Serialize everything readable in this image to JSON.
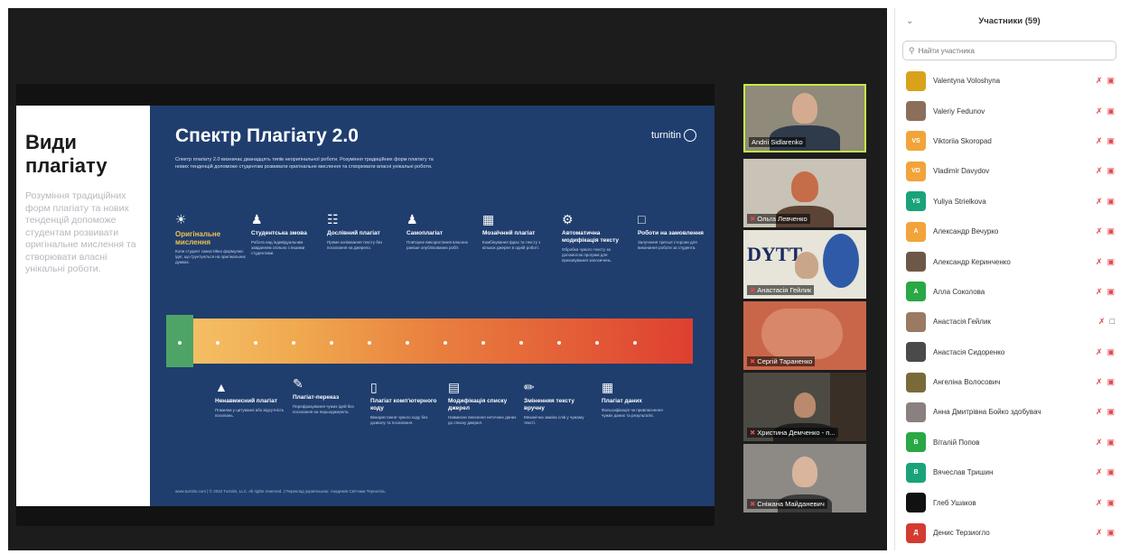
{
  "slide": {
    "left_heading": "Види плагіату",
    "left_text": "Розуміння традиційних форм плагіату та нових тенденцій допоможе студентам розвивати оригінальне мислення та створювати власні унікальні роботи.",
    "title": "Спектр Плагіату 2.0",
    "brand": "turnitin",
    "intro": "Спектр плагіату 2.0 визначає дванадцять типів неоригінальної роботи. Розуміння традиційних форм плагіату та нових тенденцій допоможе студентам розвивати оригінальне мислення та створювати власні унікальні роботи.",
    "top_items": [
      {
        "label": "Оригінальне мислення",
        "desc": "Коли студент самостійно формулює ідеї, що ґрунтуються на оригінальних думках."
      },
      {
        "label": "Студентська змова",
        "desc": "Робота над індивідуальним завданням спільно з іншими студентами."
      },
      {
        "label": "Дослівний плагіат",
        "desc": "Пряме копіювання тексту без посилання на джерело."
      },
      {
        "label": "Самоплагіат",
        "desc": "Повторне використання власних раніше опублікованих робіт."
      },
      {
        "label": "Мозаїчний плагіат",
        "desc": "Комбінування фраз та тексту з кількох джерел в одній роботі."
      },
      {
        "label": "Автоматична модифікація тексту",
        "desc": "Обробка чужого тексту за допомогою програм для приховування запозичень."
      },
      {
        "label": "Роботи на замовлення",
        "desc": "Залучення третьої сторони для виконання роботи за студента."
      }
    ],
    "bottom_items": [
      {
        "label": "Ненавмисний плагіат",
        "desc": "Помилки у цитуванні або відсутність посилань."
      },
      {
        "label": "Плагіат-переказ",
        "desc": "Перефразування чужих ідей без посилання на першоджерело."
      },
      {
        "label": "Плагіат комп'ютерного коду",
        "desc": "Використання чужого коду без дозволу та посилання."
      },
      {
        "label": "Модифікація списку джерел",
        "desc": "Навмисне внесення неточних даних до списку джерел."
      },
      {
        "label": "Зміненняя тексту вручну",
        "desc": "Механічна заміна слів у чужому тексті."
      },
      {
        "label": "Плагіат даних",
        "desc": "Фальсифікація чи привласнення чужих даних та результатів."
      }
    ],
    "footer": "www.turnitin.com | © 2022 Turnitin, LLC. All rights reserved. | Переклад українською: Академія Світчаки Тернопіль"
  },
  "tiles": [
    {
      "name": "Andrii Sidlarenko",
      "muted": false,
      "active": true
    },
    {
      "name": "Ольга Левченко",
      "muted": true,
      "active": false
    },
    {
      "name": "Анастасія Гейлик",
      "muted": true,
      "active": false,
      "logo": "DYTT"
    },
    {
      "name": "Сергій Тараненко",
      "muted": true,
      "active": false
    },
    {
      "name": "Христина Демченко - п...",
      "muted": true,
      "active": false
    },
    {
      "name": "Сніжана Майданевич",
      "muted": true,
      "active": false
    }
  ],
  "participants": {
    "title": "Участники (59)",
    "search_placeholder": "Найти участника",
    "list": [
      {
        "name": "Valentyna Voloshyna",
        "initials": "",
        "color": "#d9a21b",
        "cam_on": false
      },
      {
        "name": "Valeriy Fedunov",
        "initials": "",
        "color": "#8c6f5a",
        "cam_on": false
      },
      {
        "name": "Viktoriia Skoropad",
        "initials": "VS",
        "color": "#f2a33a",
        "cam_on": false
      },
      {
        "name": "Vladimir Davydov",
        "initials": "VD",
        "color": "#f2a33a",
        "cam_on": false
      },
      {
        "name": "Yuliya Strielkova",
        "initials": "YS",
        "color": "#1aa37a",
        "cam_on": false
      },
      {
        "name": "Александр Вечурко",
        "initials": "А",
        "color": "#f2a33a",
        "cam_on": false
      },
      {
        "name": "Александр Керинченко",
        "initials": "",
        "color": "#6d5848",
        "cam_on": false
      },
      {
        "name": "Алла Соколова",
        "initials": "А",
        "color": "#29a845",
        "cam_on": false
      },
      {
        "name": "Анастасія Гейлик",
        "initials": "",
        "color": "#9a7a63",
        "cam_on": true
      },
      {
        "name": "Анастасія Сидоренко",
        "initials": "",
        "color": "#4a4a4a",
        "cam_on": false
      },
      {
        "name": "Ангеліна Волосович",
        "initials": "",
        "color": "#7a6a3a",
        "cam_on": false
      },
      {
        "name": "Анна Дмитрівна Бойко здобувач",
        "initials": "",
        "color": "#8a8080",
        "cam_on": false
      },
      {
        "name": "Віталій Попов",
        "initials": "В",
        "color": "#29a845",
        "cam_on": false
      },
      {
        "name": "Вячеслав Тришин",
        "initials": "В",
        "color": "#1aa37a",
        "cam_on": false
      },
      {
        "name": "Глеб Ушаков",
        "initials": "",
        "color": "#111111",
        "cam_on": false
      },
      {
        "name": "Денис Терзиогло",
        "initials": "Д",
        "color": "#d33b30",
        "cam_on": false
      }
    ]
  }
}
